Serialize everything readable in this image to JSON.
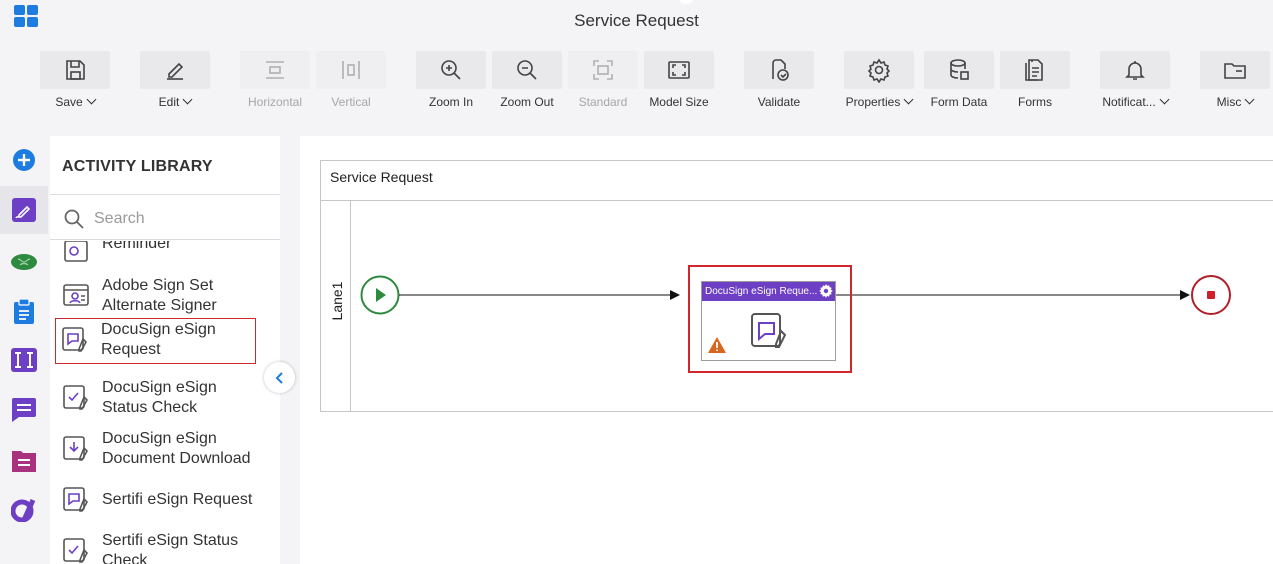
{
  "app": {
    "title": "Service Request"
  },
  "toolbar": {
    "save": "Save",
    "edit": "Edit",
    "horizontal": "Horizontal",
    "vertical": "Vertical",
    "zoom_in": "Zoom In",
    "zoom_out": "Zoom Out",
    "standard": "Standard",
    "model_size": "Model Size",
    "validate": "Validate",
    "properties": "Properties",
    "form_data": "Form Data",
    "forms": "Forms",
    "notifications": "Notificat...",
    "misc": "Misc"
  },
  "rail": {
    "icons": [
      "add-icon",
      "designer-icon",
      "brain-icon",
      "clipboard-icon",
      "text-field-icon",
      "chat-icon",
      "file-icon",
      "agilepoint-logo-icon"
    ],
    "colors": {
      "blue": "#1e7be0",
      "purple": "#6d3fc4",
      "green": "#2e8a3e",
      "magenta": "#a8327e"
    }
  },
  "library": {
    "title": "ACTIVITY LIBRARY",
    "search_placeholder": "Search",
    "items": [
      {
        "label": "Reminder"
      },
      {
        "label": "Adobe Sign Set Alternate Signer"
      },
      {
        "label": "DocuSign eSign Request",
        "selected": true
      },
      {
        "label": "DocuSign eSign Status Check"
      },
      {
        "label": "DocuSign eSign Document Download"
      },
      {
        "label": "Sertifi eSign Request"
      },
      {
        "label": "Sertifi eSign Status Check"
      }
    ]
  },
  "canvas": {
    "pool_title": "Service Request",
    "lane_label": "Lane1",
    "task_title": "DocuSign eSign Reque...",
    "colors": {
      "start": "#2e8a3e",
      "end": "#b0202a",
      "task_header": "#6d3fc4",
      "warning": "#d9661c",
      "highlight": "#d0272d"
    }
  }
}
